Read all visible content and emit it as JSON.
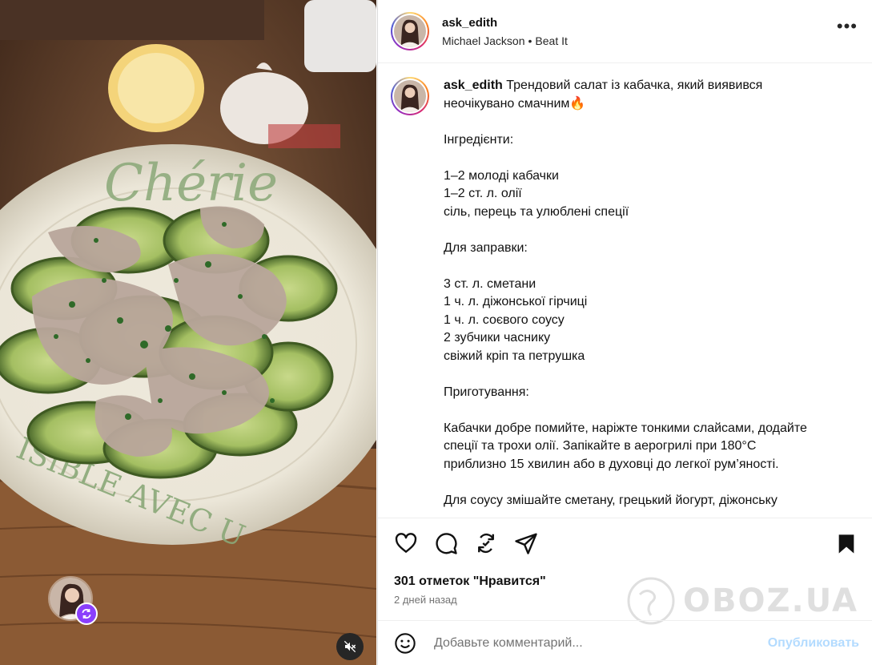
{
  "post": {
    "username": "ask_edith",
    "audio_artist": "Michael Jackson",
    "audio_title": "Beat It",
    "caption_user": "ask_edith",
    "caption_lines": [
      "Трендовий салат із кабачка, який виявився",
      "неочікувано смачним🔥",
      "",
      "Інгредієнти:",
      "",
      "1–2 молоді кабачки",
      "1–2 ст. л. олії",
      "сіль, перець та улюблені спеції",
      "",
      "Для заправки:",
      "",
      "3 ст. л. сметани",
      "1 ч. л. діжонської гірчиці",
      "1 ч. л. соєвого соусу",
      "2 зубчики часнику",
      "свіжий кріп та петрушка",
      "",
      "Приготування:",
      "",
      "Кабачки добре помийте, наріжте тонкими слайсами, додайте",
      "спеції та трохи олії. Запікайте в аерогрилі при 180°C",
      "приблизно 15 хвилин або в духовці до легкої рум’яності.",
      "",
      "Для соусу змішайте сметану, грецький йогурт, діжонську"
    ],
    "likes": "301 отметок \"Нравится\"",
    "time_ago": "2 дней назад",
    "comment_placeholder": "Добавьте комментарий...",
    "post_button": "Опубликовать"
  },
  "media": {
    "plate_text_top": "Chérie",
    "plate_text_bottom": "ISIBLE AVEC U"
  },
  "watermark": "OBOZ.UA",
  "icons": {
    "like": "heart-icon",
    "comment": "comment-icon",
    "repost": "repost-icon",
    "share": "share-icon",
    "save": "bookmark-icon",
    "more": "more-icon",
    "emoji": "emoji-icon",
    "mute": "mute-icon",
    "remix": "remix-icon"
  },
  "colors": {
    "post_button": "#b3dbff",
    "secondary_text": "#737373",
    "remix_badge": "#8a3ffc"
  }
}
